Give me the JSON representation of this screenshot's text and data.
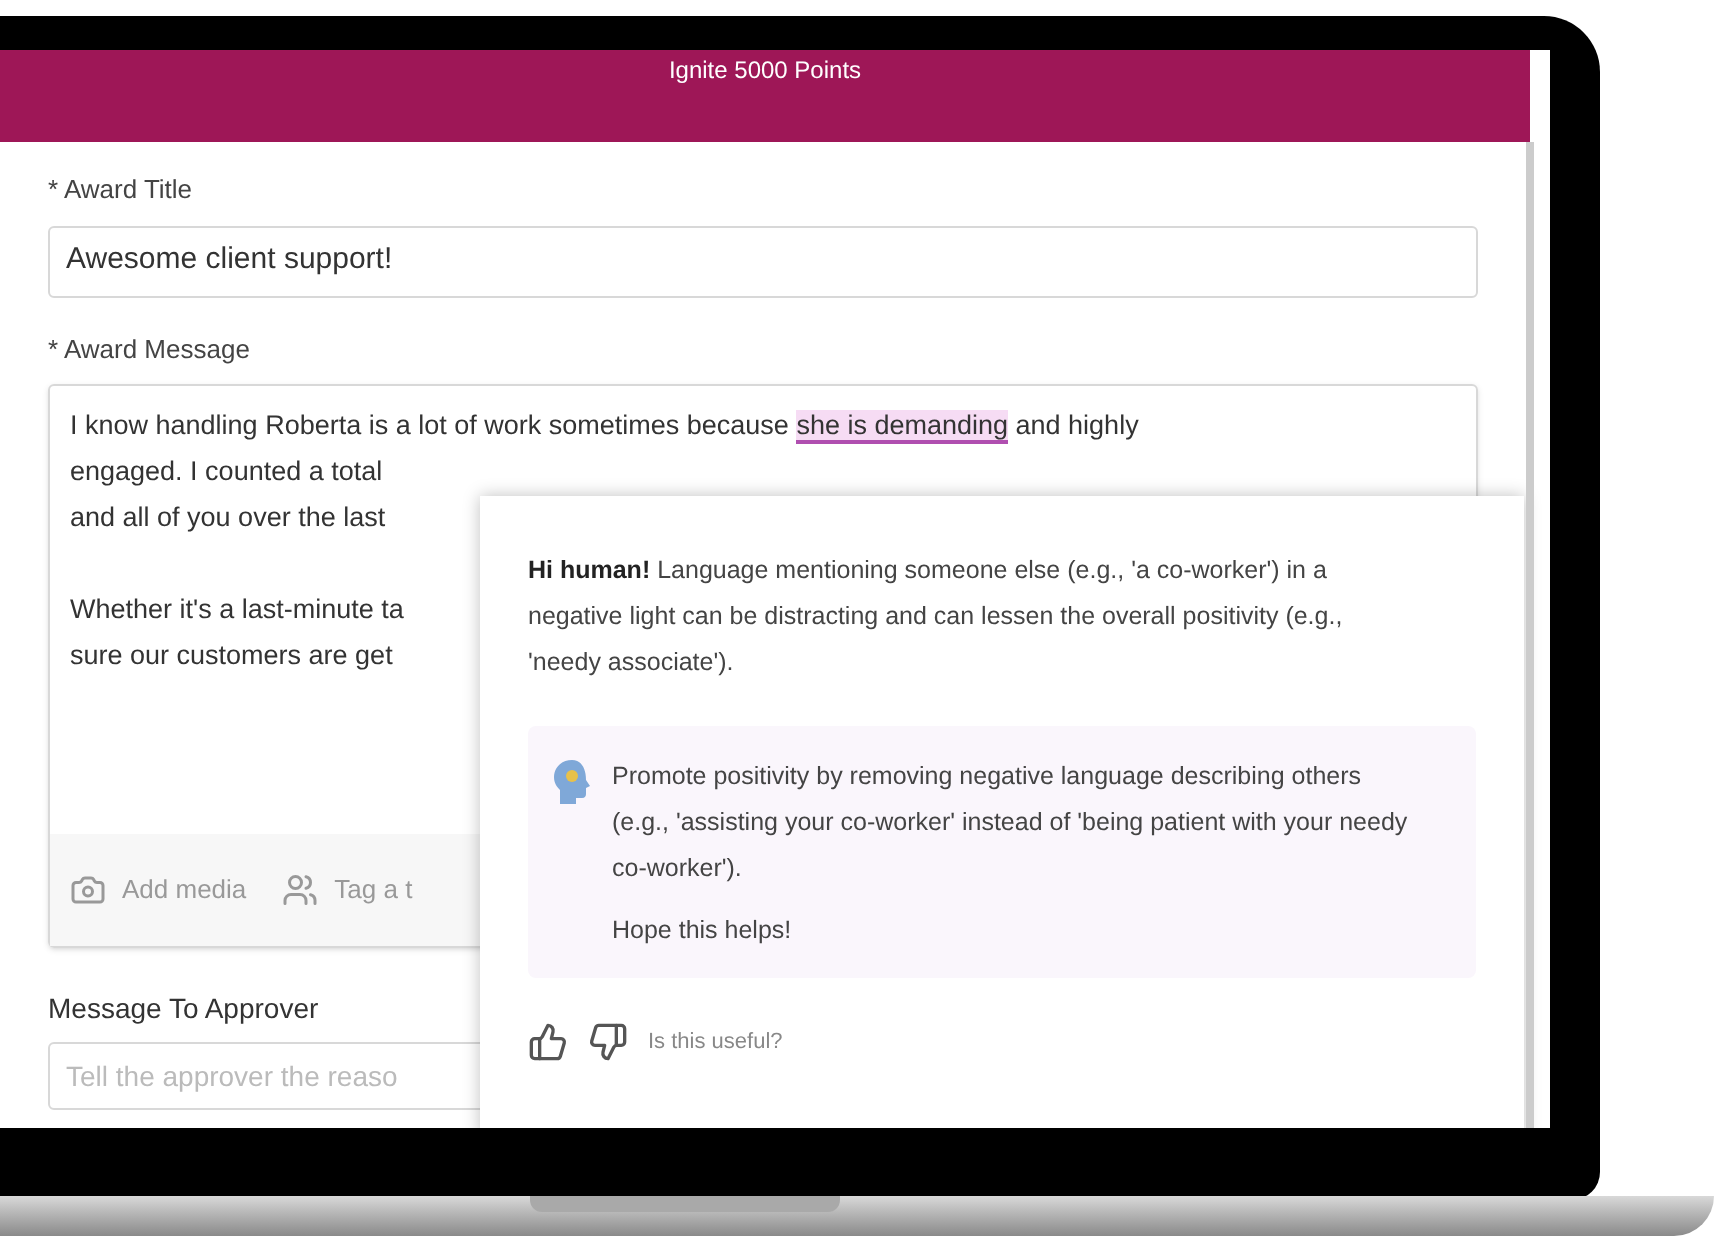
{
  "header": {
    "title": "Ignite 5000 Points"
  },
  "award_title": {
    "label": "* Award Title",
    "value": "Awesome client support!"
  },
  "award_message": {
    "label": "* Award Message",
    "paragraphs": [
      [
        {
          "before": "I know handling Roberta is a lot of work sometimes because ",
          "highlight": "she is demanding",
          "after": " and highly"
        },
        {
          "before": "engaged. I counted a total"
        },
        {
          "before": "and all of you over the last"
        }
      ],
      [
        {
          "before": "Whether it's a last-minute ta"
        },
        {
          "before": "sure our customers are get"
        }
      ]
    ],
    "toolbar": [
      "Add media",
      "Tag a t"
    ]
  },
  "approver": {
    "label": "Message To Approver",
    "placeholder": "Tell the approver the reaso"
  },
  "suggestion": {
    "greeting": "Hi human!",
    "intro": "Language mentioning someone else (e.g., 'a co-worker') in a negative light can be distracting and can lessen the overall positivity (e.g., 'needy associate').",
    "tip": "Promote positivity by removing negative language describing others (e.g., 'assisting your co-worker' instead of 'being patient with your needy co-worker').",
    "closing": "Hope this helps!",
    "feedback": "Is this useful?"
  }
}
